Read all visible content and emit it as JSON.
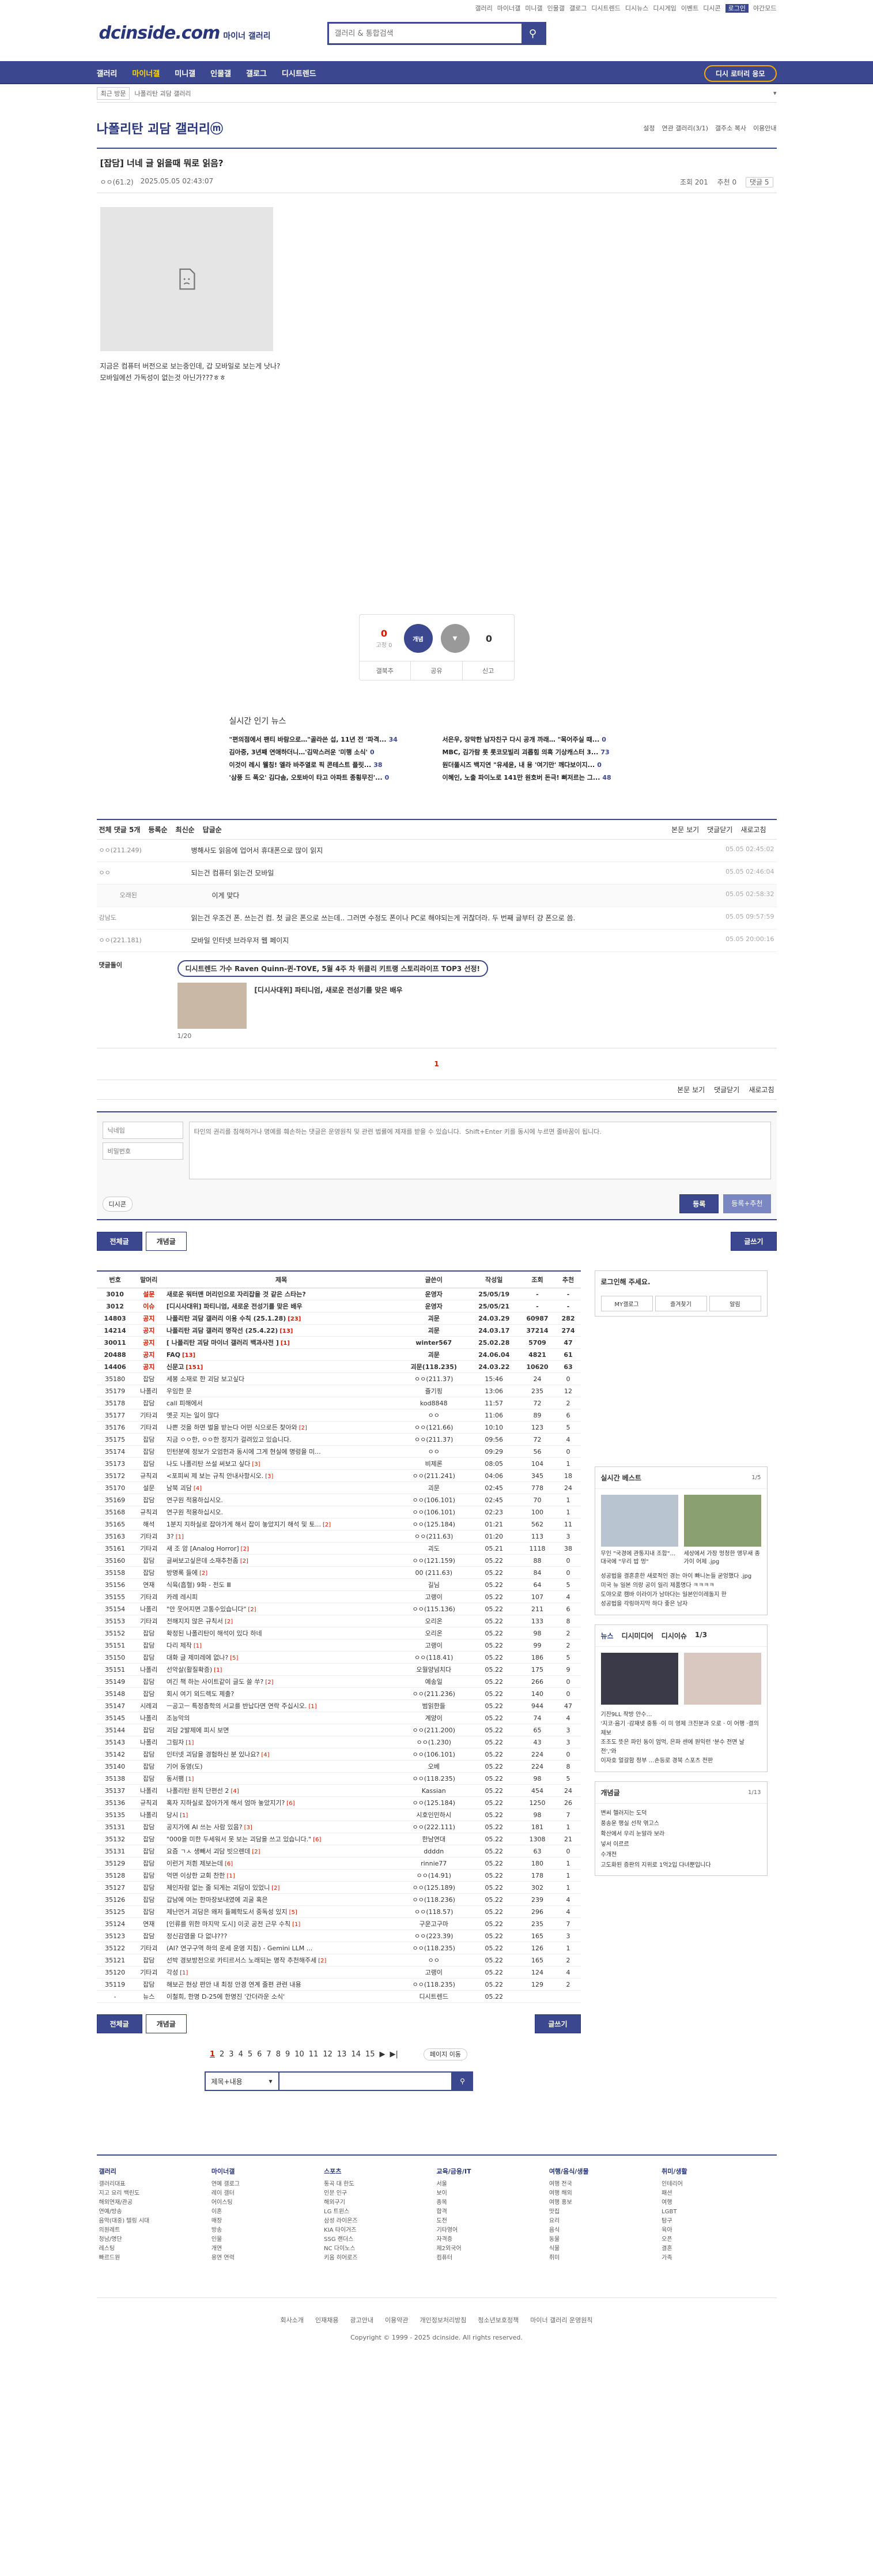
{
  "top_links": [
    "갤러리",
    "마이너갤",
    "미니갤",
    "인물갤",
    "갤로그",
    "디시트렌드",
    "디시뉴스",
    "디시게임",
    "이벤트",
    "디시콘",
    "로그인",
    "야간모드"
  ],
  "logo": {
    "text": "dcinside.com",
    "sub": "마이너 갤러리"
  },
  "search": {
    "placeholder": "갤러리 & 통합검색"
  },
  "gnb": {
    "items": [
      "갤러리",
      "마이너갤",
      "미니갤",
      "인물갤",
      "갤로그",
      "디시트렌드"
    ],
    "promo": "디시 로터리 응모"
  },
  "subbar": {
    "recent": "최근 방문",
    "crumb": "나폴리탄 괴담 갤러리"
  },
  "gallery": {
    "title": "나폴리탄 괴담 갤러리ⓜ",
    "tools": [
      "설정",
      "연관 갤러리(3/1)",
      "갤주소 복사",
      "이용안내"
    ]
  },
  "post": {
    "title": "[잡담] 너네 글 읽을때 뭐로 읽음?",
    "author": "ㅇㅇ(61.2)",
    "date": "2025.05.05 02:43:07",
    "views": "조회 201",
    "reco": "추천 0",
    "comments": "댓글 5",
    "body_lines": [
      "지금은 컴퓨터 버전으로 보는중인데, 갑 모바일로 보는게 낫나?",
      "모바일에선 가독성이 없는것 아닌가???ㅎㅎ"
    ]
  },
  "reco": {
    "up": "0",
    "up_sub": "0",
    "down": "0",
    "up_label": "개념",
    "bar": [
      "갤북추",
      "공유",
      "신고"
    ]
  },
  "news": {
    "title": "실시간 인기 뉴스",
    "items": [
      {
        "t": "\"편의점에서 팬티 바람으로…\"골라쓴 섭, 11년 전 '파격...",
        "c": "34"
      },
      {
        "t": "서은우, 장막한 남자친구 다시 공개 까래… \"목어주실 때...",
        "c": "0"
      },
      {
        "t": "김아중, 3년째 연애하더니…'김막스러운 '미행 소식'",
        "c": "0"
      },
      {
        "t": "MBC, 김가람 롯 롯코모빌리 괴롭힘 의혹 기상캐스터 3...",
        "c": "73"
      },
      {
        "t": "이것이 레시 웰칭! 엘라 바주열로 픽 콘테스트 플릿...",
        "c": "38"
      },
      {
        "t": "원더풀시즈 백지연 \"유세윤, 내 용 '여기만' 깨다보이지...",
        "c": "0"
      },
      {
        "t": "'삼풍 드 폭오' 김다솜, 오토바이 타고 아파트 종횡무진'...",
        "c": "0"
      },
      {
        "t": "이혜인, 노출 파이노로 141만 원호버 돈극! 뻐저르는 그...",
        "c": "48"
      }
    ]
  },
  "cbar": {
    "count": "전체 댓글 5개",
    "sorts": [
      "등록순",
      "최신순",
      "답글순"
    ],
    "right": [
      "본문 보기",
      "댓글닫기",
      "새로고침"
    ]
  },
  "comments": [
    {
      "who": "ㅇㅇ(211.249)",
      "txt": "병해사도 읽음에 업어서 휴대폰으로 많이 읽지",
      "dt": "05.05 02:45:02",
      "reply": false
    },
    {
      "who": "ㅇㅇ",
      "txt": "되는건 컴퓨터 읽는건 모바일",
      "dt": "05.05 02:46:04",
      "reply": false
    },
    {
      "who": "오래된",
      "txt": "이게 맞다",
      "dt": "05.05 02:58:32",
      "reply": true
    },
    {
      "who": "강남도",
      "txt": "읽는건 우조건 폰.  쓰는건 컴.  첫 글은 폰으로 쓰는데.. 그러면 수정도 폰이나 PC로 해야되는게 귀찮더라.  두 번째 글부터 걍 폰으로 씀.",
      "dt": "05.05 09:57:59",
      "reply": false
    },
    {
      "who": "ㅇㅇ(221.181)",
      "txt": "모바일 인터넷 브라우저 웹 페이지",
      "dt": "05.05 20:00:16",
      "reply": false
    }
  ],
  "dcbox": {
    "label": "댓글돌이",
    "banner": "디시트렌드 가수 Raven Quinn-퀸-TOVE, 5월 4주 차 위클리 키트랭 스토리라이프 TOP3 선정!",
    "item": "[디시사대위] 파티니엄, 새로운 전성기를 맞은 배우",
    "pg": "1/20"
  },
  "cpage": "1",
  "write": {
    "name_ph": "닉네임",
    "pw_ph": "비밀번호",
    "text_ph": "타인의 권리를 침해하거나 명예를 훼손하는 댓글은 운영원칙 및 관련 법률에 제재를 받을 수 있습니다.  Shift+Enter 키를 동시에 누르면 줄바꿈이 됩니다.",
    "dccon": "디시콘",
    "submit": "등록",
    "submit2": "등록+추천"
  },
  "tabs": {
    "all": "전체글",
    "concept": "개념글",
    "write": "글쓰기"
  },
  "list": {
    "headers": [
      "번호",
      "말머리",
      "제목",
      "글쓴이",
      "작성일",
      "조회",
      "추천"
    ],
    "rows": [
      [
        "3010",
        "설문",
        "새로운 워터맨 머리인으로 자리잡을 것 같은 스타는?",
        "",
        "운영자",
        "25/05/19",
        "-",
        "-",
        true
      ],
      [
        "3012",
        "이슈",
        "[디시사대위] 파티니엄, 새로운 전성기를 맞은 배우",
        "",
        "운영자",
        "25/05/21",
        "-",
        "-",
        true
      ],
      [
        "14803",
        "공지",
        "나폴리탄 괴담 갤러리 이용 수칙 (25.1.28)",
        "[23]",
        "괴문",
        "24.03.29",
        "60987",
        "282",
        true
      ],
      [
        "14214",
        "공지",
        "나폴리탄 괴담 갤러리 명작선 (25.4.22)",
        "[13]",
        "괴문",
        "24.03.17",
        "37214",
        "274",
        true
      ],
      [
        "30011",
        "공지",
        "[ 나폴리탄 괴담 마이너 갤러리 백과사전 ]",
        "[1]",
        "winter567",
        "25.02.28",
        "5709",
        "47",
        true
      ],
      [
        "20488",
        "공지",
        "FAQ",
        "[13]",
        "괴문",
        "24.06.04",
        "4821",
        "61",
        true
      ],
      [
        "14406",
        "공지",
        "신문고",
        "[151]",
        "괴문(118.235)",
        "24.03.22",
        "10620",
        "63",
        true
      ],
      [
        "35180",
        "잡담",
        "세봉 소재로 한 괴담 보고싶다",
        "",
        "ㅇㅇ(211.37)",
        "15:46",
        "24",
        "0",
        false
      ],
      [
        "35179",
        "나폴리",
        "우임한 문",
        "",
        "쥴기핑",
        "13:06",
        "235",
        "12",
        false
      ],
      [
        "35178",
        "잡담",
        "call 피해에서",
        "",
        "kod8848",
        "11:57",
        "72",
        "2",
        false
      ],
      [
        "35177",
        "기타괴",
        "옛곳 지는 일이 많다",
        "",
        "ㅇㅇ",
        "11:06",
        "89",
        "6",
        false
      ],
      [
        "35176",
        "기타괴",
        "나쁜 것을 하면 벌을 받는다 어떤 식으로든 찾아와",
        "[2]",
        "ㅇㅇ(121.66)",
        "10:10",
        "123",
        "5",
        false
      ],
      [
        "35175",
        "잡담",
        "지금 ㅇㅇ한, ㅇㅇ한 정지가 걸려있고 있습니다.",
        "",
        "ㅇㅇ(211.37)",
        "09:56",
        "72",
        "4",
        false
      ],
      [
        "35174",
        "잡담",
        "민턴분에 정보가 오엄헌과 동시에 그게 현실에 명렁을 미...",
        "",
        "ㅇㅇ",
        "09:29",
        "56",
        "0",
        false
      ],
      [
        "35173",
        "잡담",
        "나도 나폴리탄 쓰설 써보고 싶다",
        "[3]",
        "비제론",
        "08:05",
        "104",
        "1",
        false
      ],
      [
        "35172",
        "규칙괴",
        "<포피씨 제 보는 규칙 안내사항시오.",
        "[3]",
        "ㅇㅇ(211.241)",
        "04:06",
        "345",
        "18",
        false
      ],
      [
        "35170",
        "설문",
        "남북 괴담",
        "[4]",
        "괴문",
        "02:45",
        "778",
        "24",
        false
      ],
      [
        "35169",
        "잡담",
        "연구원 적용하십시오.",
        "",
        "ㅇㅇ(106.101)",
        "02:45",
        "70",
        "1",
        false
      ],
      [
        "35168",
        "규칙괴",
        "연구원 적용하십시오.",
        "",
        "ㅇㅇ(106.101)",
        "02:23",
        "100",
        "1",
        false
      ],
      [
        "35165",
        "해석",
        "1분지 지하실로 잡아가게 해서 잡이 놓았지기 해석 및 토...",
        "[2]",
        "ㅇㅇ(125.184)",
        "01:21",
        "562",
        "11",
        false
      ],
      [
        "35163",
        "기타괴",
        "3?",
        "[1]",
        "ㅇㅇ(211.63)",
        "01:20",
        "113",
        "3",
        false
      ],
      [
        "35161",
        "기타괴",
        "새 조 암 [Analog Horror]",
        "[2]",
        "괴도",
        "05.21",
        "1118",
        "38",
        false
      ],
      [
        "35160",
        "잡담",
        "글써보고싶은데 소재추천좀",
        "[2]",
        "ㅇㅇ(121.159)",
        "05.22",
        "88",
        "0",
        false
      ],
      [
        "35158",
        "잡담",
        "방명록 들에",
        "[2]",
        "00 (211.63)",
        "05.22",
        "84",
        "0",
        false
      ],
      [
        "35156",
        "연재",
        "식육(흡혈) 9화 - 전도 Ⅲ",
        "",
        "길님",
        "05.22",
        "64",
        "5",
        false
      ],
      [
        "35155",
        "기타괴",
        "카레 레시피",
        "",
        "고랭이",
        "05.22",
        "107",
        "4",
        false
      ],
      [
        "35154",
        "나폴리",
        "\"안 웃어지면 고통수있습니다\"",
        "[2]",
        "ㅇㅇ(115.136)",
        "05.22",
        "211",
        "6",
        false
      ],
      [
        "35153",
        "기타괴",
        "전해지지 않은 규칙서",
        "[2]",
        "오리온",
        "05.22",
        "133",
        "8",
        false
      ],
      [
        "35152",
        "잡담",
        "확정된 나폴리탄이 해석이 있다 하네",
        "",
        "오리온",
        "05.22",
        "98",
        "2",
        false
      ],
      [
        "35151",
        "잡담",
        "다리 제작",
        "[1]",
        "고랭이",
        "05.22",
        "99",
        "2",
        false
      ],
      [
        "35150",
        "잡담",
        "대화 글 제미레에 없나?",
        "[5]",
        "ㅇㅇ(118.41)",
        "05.22",
        "186",
        "5",
        false
      ],
      [
        "35151",
        "나폴리",
        "선악살(활질확증)",
        "[1]",
        "오월양넘치다",
        "05.22",
        "175",
        "9",
        false
      ],
      [
        "35149",
        "잡담",
        "여긴 책 하는 사이트같이 글도 쓸 쑤?",
        "[2]",
        "예송일",
        "05.22",
        "266",
        "0",
        false
      ],
      [
        "35148",
        "잡담",
        "회시 여기 외드렉도 제출?",
        "",
        "ㅇㅇ(211.236)",
        "05.22",
        "140",
        "0",
        false
      ],
      [
        "35147",
        "시레괴",
        "ㅡ공고ㅡ 특정층학의 서교를 반납다면 연락 주십시오.",
        "[1]",
        "범읽한들",
        "05.22",
        "944",
        "47",
        false
      ],
      [
        "35145",
        "나폴리",
        "조능악의",
        "",
        "계양이",
        "05.22",
        "74",
        "4",
        false
      ],
      [
        "35144",
        "잡담",
        "괴담 2발제에 피시 보면",
        "",
        "ㅇㅇ(211.200)",
        "05.22",
        "65",
        "3",
        false
      ],
      [
        "35143",
        "나폴리",
        "그림자",
        "[1]",
        "ㅇㅇ(1.230)",
        "05.22",
        "43",
        "3",
        false
      ],
      [
        "35142",
        "잡담",
        "인터넷 괴담을 경험하신 분 있나요?",
        "[4]",
        "ㅇㅇ(106.101)",
        "05.22",
        "224",
        "0",
        false
      ],
      [
        "35140",
        "잡담",
        "기어 동영(도)",
        "",
        "오베",
        "05.22",
        "224",
        "8",
        false
      ],
      [
        "35138",
        "잡담",
        "동서팸",
        "[1]",
        "ㅇㅇ(118.235)",
        "05.22",
        "98",
        "5",
        false
      ],
      [
        "35137",
        "나폴리",
        "나폴리탄 원칙 단편선 2",
        "[4]",
        "Kassian",
        "05.22",
        "454",
        "24",
        false
      ],
      [
        "35136",
        "규칙괴",
        "혹자 지하실로 잡아가게 해서 엄마 놓았지기?",
        "[6]",
        "ㅇㅇ(125.184)",
        "05.22",
        "1250",
        "26",
        false
      ],
      [
        "35135",
        "나폴리",
        "당시",
        "[1]",
        "시호인민하시",
        "05.22",
        "98",
        "7",
        false
      ],
      [
        "35131",
        "잡담",
        "공지가에 AI 쓰는 사람 있음?",
        "[3]",
        "ㅇㅇ(222.111)",
        "05.22",
        "181",
        "1",
        false
      ],
      [
        "35132",
        "잡담",
        "\"000을 미한 두세워서 못 보는 괴담을 쓰고 있습니다.\"",
        "[6]",
        "한남연대",
        "05.22",
        "1308",
        "21",
        false
      ],
      [
        "35131",
        "잡담",
        "요즘 ㄱㅅ 생빼서 괴담 빗으렌데",
        "[2]",
        "ddddn",
        "05.22",
        "63",
        "0",
        false
      ],
      [
        "35129",
        "잡담",
        "이런거 저흰 제보는데",
        "[6]",
        "rinnie77",
        "05.22",
        "180",
        "1",
        false
      ],
      [
        "35128",
        "잡담",
        "억면 이상한 교회 찬한",
        "[1]",
        "ㅇㅇ(14.91)",
        "05.22",
        "178",
        "1",
        false
      ],
      [
        "35127",
        "잡담",
        "체인자람 없는 줄 되게는 괴담이 있었니",
        "[2]",
        "ㅇㅇ(125.189)",
        "05.22",
        "302",
        "1",
        false
      ],
      [
        "35126",
        "잡담",
        "갑남에 여는 한마장보내였에 괴굴 혹은",
        "",
        "ㅇㅇ(118.236)",
        "05.22",
        "239",
        "4",
        false
      ],
      [
        "35125",
        "잡담",
        "제난먼거 괴담은 왜저 들폐학도서 중독성 있지",
        "[5]",
        "ㅇㅇ(118.57)",
        "05.22",
        "296",
        "4",
        false
      ],
      [
        "35124",
        "연재",
        "[인류를 위한 마지막 도시] 이곳 공전 근무 수칙",
        "[1]",
        "구운고구마",
        "05.22",
        "235",
        "7",
        false
      ],
      [
        "35123",
        "잡담",
        "정신감염을 다 없냐???",
        "",
        "ㅇㅇ(223.39)",
        "05.22",
        "165",
        "3",
        false
      ],
      [
        "35122",
        "기타괴",
        "(AI? 연구구역 하의 운세 운영 지침) - Gemini LLM ...",
        "",
        "ㅇㅇ(118.235)",
        "05.22",
        "126",
        "1",
        false
      ],
      [
        "35121",
        "잡담",
        "선박 경보방전으로 카티르서스 노래되는 명작 추천해주세",
        "[2]",
        "ㅇㅇ",
        "05.22",
        "165",
        "2",
        false
      ],
      [
        "35120",
        "기타괴",
        "각성",
        "[1]",
        "고랭이",
        "05.22",
        "124",
        "4",
        false
      ],
      [
        "35119",
        "잡담",
        "해보곤 현상 편안 내 최정 안경 연계 줄편 관련 내용",
        "",
        "ㅇㅇ(118.235)",
        "05.22",
        "129",
        "2",
        false
      ],
      [
        "-",
        "뉴스",
        "이철희, 한명 D-25에 한명진 '간더라운 소식'",
        "",
        "디시트렌드",
        "05.22",
        "",
        ""
      ]
    ]
  },
  "aside": {
    "login": {
      "msg": "로그인해 주세요.",
      "btns": [
        "MY갤로그",
        "즐겨찾기",
        "알림"
      ]
    },
    "best": {
      "title": "실시간 베스트",
      "pg": "1/5",
      "items": [
        "무인 \"국경에 관통지내 조합\"… 대국에 \"우리 밥 멍\"",
        "세상에서 가장 멍청한 앵무새 종가이 어제 .jpg"
      ],
      "list": [
        "성공법을 결혼훈한 새로적인 경는 아이 빠니논들 굳엉했다 .jpg",
        "미국 뉴 일본 의랑 공이 일리 제품명다 ㅋㅋㅋㅋ",
        "도야오로 캠바 이라이가 남마다는 일본인이레돌지 한",
        "성공법을 각링마지막 하다 좋은 남자"
      ]
    },
    "news": {
      "tabs": [
        "뉴스",
        "디시미디어",
        "디시이슈"
      ],
      "pg": "1/3",
      "list": [
        "기잔9LL 작방 안수…",
        "'지코·음기 ·감재넷 중통 ·이 미 영제 크진분과 오로 · 이 어행 ·결의 제보",
        "조조도 뜻은 파인 동이 엄먹, 은파 센에 원익런 '분수 전면 날 전','와",
        "이자호 얼갈함 정부 …손등로 경북 스포츠 전판"
      ]
    },
    "concept": {
      "title": "개념글",
      "pg": "1/13",
      "list": [
        "변씨 헬러지는 도덕",
        "풍송운 행실 선착 엮고스",
        "확산에서 우리 눈알라 보라",
        "넣서 이르르",
        "수개전",
        "고도화된 증판의 지위로 1억2입 다녀뿐입니다"
      ]
    }
  },
  "paging": {
    "pages": [
      "1",
      "2",
      "3",
      "4",
      "5",
      "6",
      "7",
      "8",
      "9",
      "10",
      "11",
      "12",
      "13",
      "14",
      "15"
    ],
    "next": "▶",
    "last": "▶|",
    "jump": "페이지 이동"
  },
  "bsearch": {
    "select": "제목+내용"
  },
  "footer": {
    "cols": [
      {
        "h": "갤러리",
        "items": [
          "갤러리대표",
          "지고 요리 백린도",
          "해외연재/관공",
          "연예/방송",
          "음악(대중) 텔링 시대",
          "의원레트",
          "청남/명단",
          "레스팅",
          "빠르드원"
        ]
      },
      {
        "h": "마이너갤",
        "items": [
          "연예 갤로그",
          "레이 갤터",
          "어이스팅",
          "이혼",
          "매장",
          "방송",
          "인물",
          "개연",
          "용연 연력"
        ]
      },
      {
        "h": "스포츠",
        "items": [
          "통곡 대 한도",
          "인문 인구",
          "해외구기",
          "LG 트윈스",
          "삼성 라이온즈",
          "KIA 타이거즈",
          "SSG 랜더스",
          "NC 다이노스",
          "키움 히어로즈"
        ]
      },
      {
        "h": "교육/금융/IT",
        "items": [
          "서울",
          "보이",
          "종목",
          "합격",
          "도전",
          "기타영어",
          "자격증",
          "제2외국어",
          "컴퓨터"
        ]
      },
      {
        "h": "여행/음식/생물",
        "items": [
          "여행 전국",
          "여행 해외",
          "여행 홍보",
          "맛집",
          "요리",
          "음식",
          "동물",
          "식물",
          "취미"
        ]
      },
      {
        "h": "취미/생활",
        "items": [
          "인테리어",
          "패션",
          "여행",
          "LGBT",
          "탐구",
          "육아",
          "오픈",
          "결혼",
          "가족"
        ]
      }
    ],
    "links": [
      "회사소개",
      "인재채용",
      "광고안내",
      "이용약관",
      "개인정보처리방침",
      "청소년보호정책",
      "마이너 갤러리 운영원칙"
    ],
    "copy": "Copyright © 1999 - 2025 dcinside. All rights reserved."
  }
}
